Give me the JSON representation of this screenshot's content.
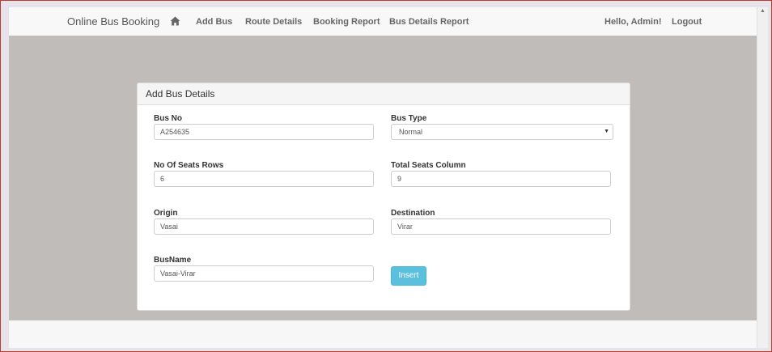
{
  "navbar": {
    "brand": "Online Bus Booking",
    "home_icon": "home-icon",
    "items": [
      {
        "label": "Add Bus"
      },
      {
        "label": "Route Details"
      },
      {
        "label": "Booking Report"
      },
      {
        "label": "Bus Details Report"
      }
    ],
    "greeting": "Hello, Admin!",
    "logout": "Logout"
  },
  "panel": {
    "title": "Add Bus Details",
    "fields": {
      "bus_no": {
        "label": "Bus No",
        "value": "A254635"
      },
      "bus_type": {
        "label": "Bus Type",
        "value": "Normal"
      },
      "seat_rows": {
        "label": "No Of Seats Rows",
        "value": "6"
      },
      "seat_columns": {
        "label": "Total Seats Column",
        "value": "9"
      },
      "origin": {
        "label": "Origin",
        "value": "Vasai"
      },
      "destination": {
        "label": "Destination",
        "value": "Virar"
      },
      "bus_name": {
        "label": "BusName",
        "value": "Vasai-Virar"
      }
    },
    "insert_label": "Insert"
  },
  "colors": {
    "stage_background": "#c0bcb9",
    "insert_button": "#5bc0de",
    "window_border": "#c0392b"
  }
}
